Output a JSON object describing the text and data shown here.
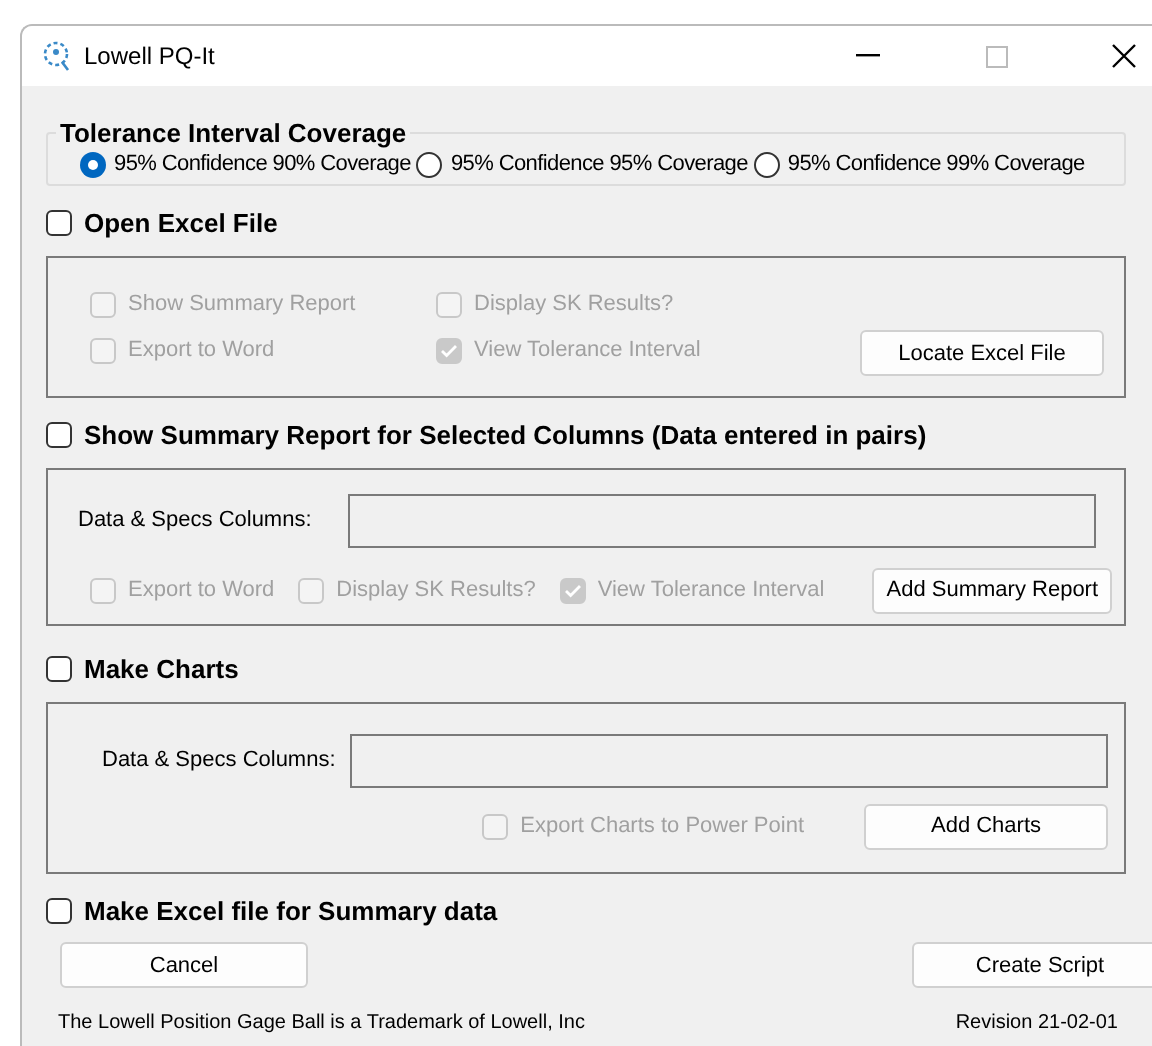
{
  "window": {
    "title": "Lowell PQ-It"
  },
  "coverage": {
    "title": "Tolerance Interval Coverage",
    "options": [
      {
        "label": "95% Confidence 90% Coverage",
        "selected": true
      },
      {
        "label": "95% Confidence 95% Coverage",
        "selected": false
      },
      {
        "label": "95% Confidence 99% Coverage",
        "selected": false
      }
    ]
  },
  "sections": [
    {
      "label": "Open Excel File",
      "checked": false,
      "panel": {
        "kind": "grid",
        "options": [
          {
            "label": "Show Summary Report",
            "checked": false,
            "disabled": true
          },
          {
            "label": "Display SK Results?",
            "checked": false,
            "disabled": true
          },
          {
            "label": "Export to Word",
            "checked": false,
            "disabled": true
          },
          {
            "label": "View Tolerance Interval",
            "checked": true,
            "disabled": true
          }
        ],
        "button": "Locate Excel File"
      }
    },
    {
      "label": "Show Summary Report for Selected Columns (Data entered in pairs)",
      "checked": false,
      "panel": {
        "kind": "field",
        "field_label": "Data & Specs Columns:",
        "options": [
          {
            "label": "Export to Word",
            "checked": false,
            "disabled": true
          },
          {
            "label": "Display SK Results?",
            "checked": false,
            "disabled": true
          },
          {
            "label": "View Tolerance Interval",
            "checked": true,
            "disabled": true
          }
        ],
        "button": "Add Summary Report"
      }
    },
    {
      "label": "Make Charts",
      "checked": false,
      "panel": {
        "kind": "field",
        "field_label": "Data & Specs Columns:",
        "options": [
          {
            "label": "Export Charts to Power Point",
            "checked": false,
            "disabled": true
          }
        ],
        "button": "Add Charts"
      }
    },
    {
      "label": "Make Excel file for Summary data",
      "checked": false
    }
  ],
  "buttons": [
    "Cancel",
    "Create Script"
  ],
  "footer": {
    "trademark": "The Lowell Position Gage Ball is a Trademark of Lowell, Inc",
    "revision": "Revision 21-02-01"
  }
}
